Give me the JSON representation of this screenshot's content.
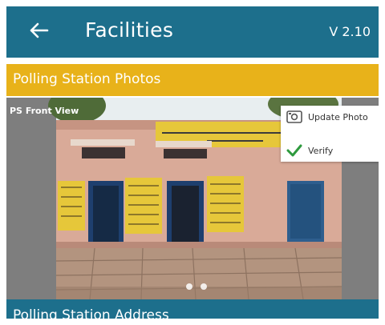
{
  "app": {
    "title": "Facilities",
    "version": "V 2.10"
  },
  "colors": {
    "appbar": "#1d6f8c",
    "section_header": "#e8b21a",
    "photo_bg": "#7e7e7e",
    "verify_check": "#2e9a3e"
  },
  "icons": {
    "back": "arrow-left",
    "update_photo": "photo-icon",
    "verify": "check-icon"
  },
  "section": {
    "photos_title": "Polling Station Photos",
    "address_title": "Polling Station Address"
  },
  "photo": {
    "caption": "PS Front View",
    "carousel_count": 2,
    "carousel_active": 1
  },
  "menu": {
    "update_photo": "Update Photo",
    "verify": "Verify"
  }
}
